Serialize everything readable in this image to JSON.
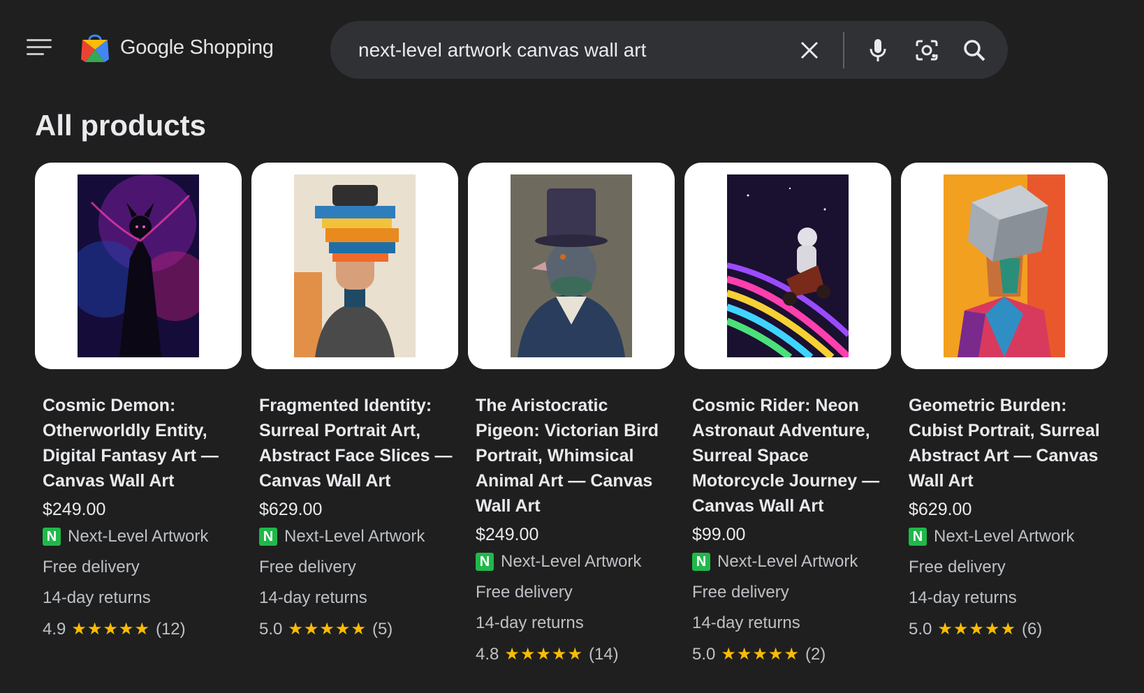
{
  "header": {
    "brand": "Google Shopping",
    "search_query": "next-level artwork canvas wall art"
  },
  "page_title": "All products",
  "products": [
    {
      "title_lines": [
        "Cosmic Demon:",
        "Otherworldly Entity,",
        "Digital Fantasy Art —",
        "Canvas Wall Art"
      ],
      "price": "$249.00",
      "seller": "Next-Level Artwork",
      "delivery": "Free delivery",
      "returns": "14-day returns",
      "rating": "4.9",
      "stars": "★★★★★",
      "reviews": "(12)"
    },
    {
      "title_lines": [
        "Fragmented Identity:",
        "Surreal Portrait Art,",
        "Abstract Face Slices —",
        "Canvas Wall Art"
      ],
      "price": "$629.00",
      "seller": "Next-Level Artwork",
      "delivery": "Free delivery",
      "returns": "14-day returns",
      "rating": "5.0",
      "stars": "★★★★★",
      "reviews": "(5)"
    },
    {
      "title_lines": [
        "The Aristocratic",
        "Pigeon: Victorian Bird",
        "Portrait, Whimsical",
        "Animal Art — Canvas",
        "Wall Art"
      ],
      "price": "$249.00",
      "seller": "Next-Level Artwork",
      "delivery": "Free delivery",
      "returns": "14-day returns",
      "rating": "4.8",
      "stars": "★★★★★",
      "reviews": "(14)"
    },
    {
      "title_lines": [
        "Cosmic Rider: Neon",
        "Astronaut Adventure,",
        "Surreal Space",
        "Motorcycle Journey —",
        "Canvas Wall Art"
      ],
      "price": "$99.00",
      "seller": "Next-Level Artwork",
      "delivery": "Free delivery",
      "returns": "14-day returns",
      "rating": "5.0",
      "stars": "★★★★★",
      "reviews": "(2)"
    },
    {
      "title_lines": [
        "Geometric Burden:",
        "Cubist Portrait, Surreal",
        "Abstract Art — Canvas",
        "Wall Art"
      ],
      "price": "$629.00",
      "seller": "Next-Level Artwork",
      "delivery": "Free delivery",
      "returns": "14-day returns",
      "rating": "5.0",
      "stars": "★★★★★",
      "reviews": "(6)"
    }
  ],
  "seller_badge_letter": "N",
  "colors": {
    "background": "#1f1f1f",
    "search_bg": "#303134",
    "star": "#fbbc04",
    "badge": "#20b84a"
  }
}
